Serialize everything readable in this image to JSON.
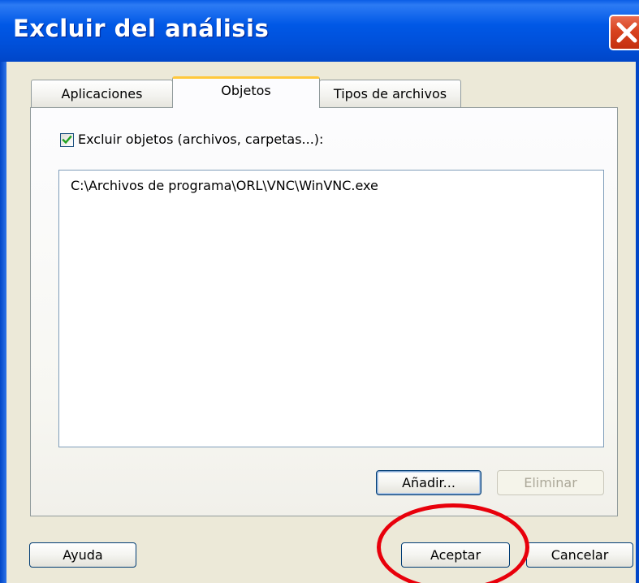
{
  "window": {
    "title": "Excluir del análisis",
    "close_icon": "close-icon"
  },
  "tabs": [
    {
      "label": "Aplicaciones",
      "active": false
    },
    {
      "label": "Objetos",
      "active": true
    },
    {
      "label": "Tipos de archivos",
      "active": false
    }
  ],
  "objects_panel": {
    "exclude_checkbox": {
      "label": "Excluir objetos (archivos, carpetas...):",
      "checked": true
    },
    "list_items": [
      "C:\\Archivos de programa\\ORL\\VNC\\WinVNC.exe"
    ],
    "add_button": "Añadir...",
    "remove_button": "Eliminar"
  },
  "footer": {
    "help_button": "Ayuda",
    "ok_button": "Aceptar",
    "cancel_button": "Cancelar"
  },
  "annotation": {
    "color": "#E8000B",
    "target": "ok_button"
  },
  "colors": {
    "titlebar": "#0058E6",
    "dialog_bg": "#ECE9D8",
    "active_tab_accent": "#FFC83C",
    "checkmark": "#21A121"
  }
}
